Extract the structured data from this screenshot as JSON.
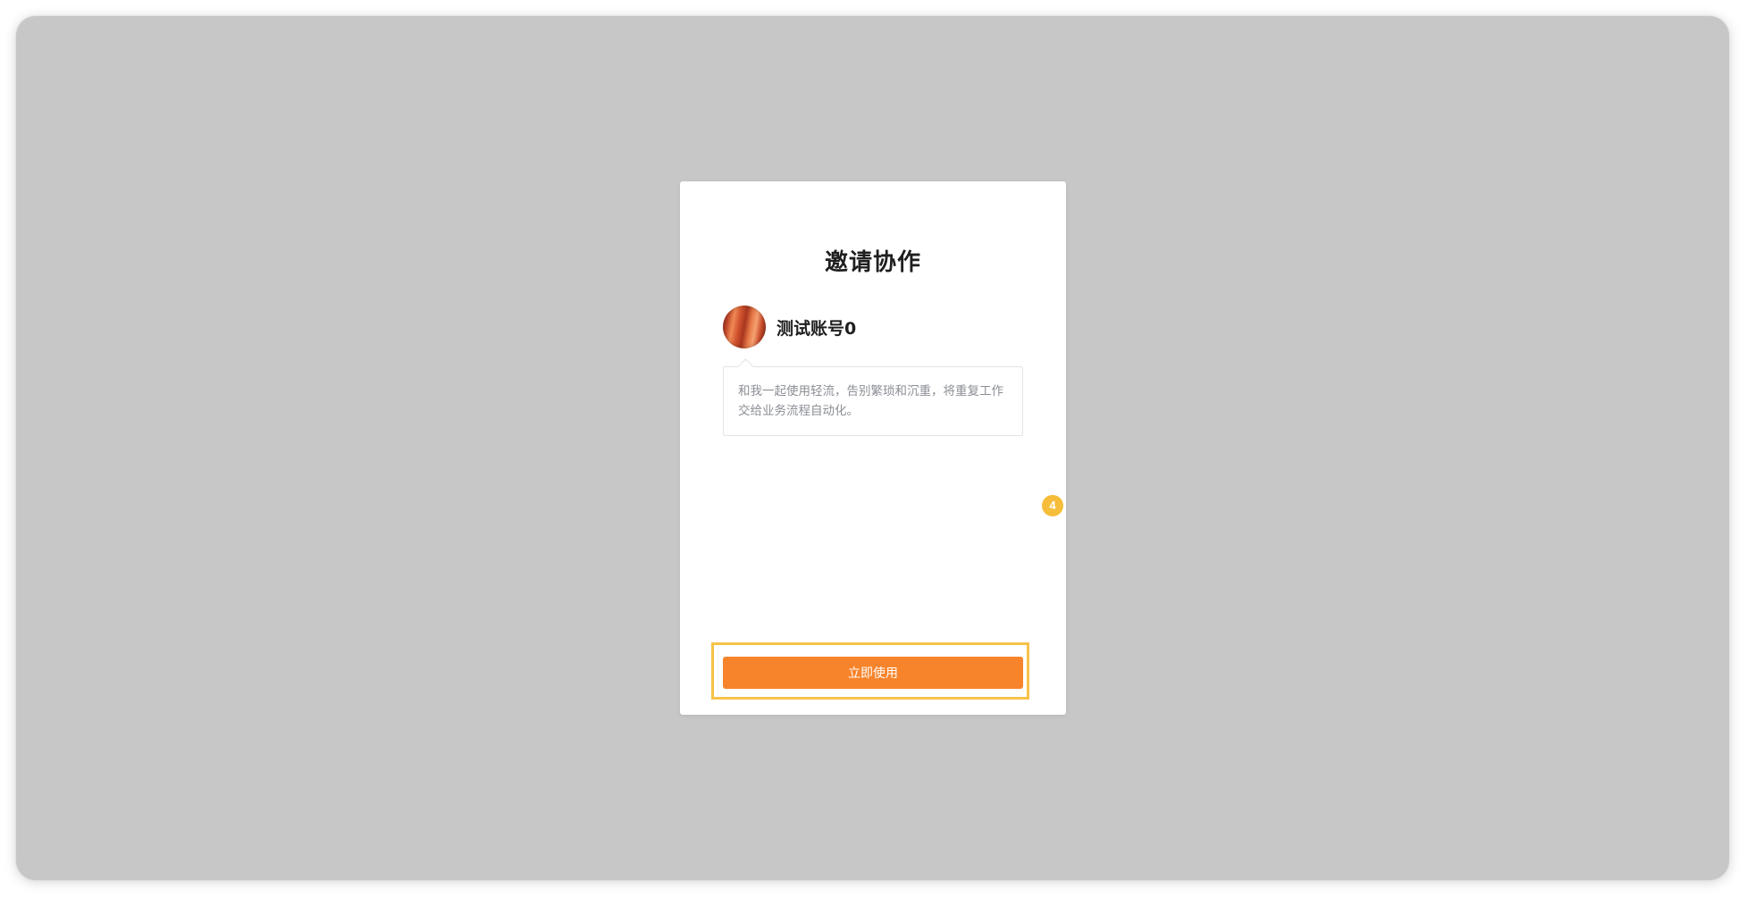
{
  "dialog": {
    "title": "邀请协作",
    "sender": {
      "avatar_icon": "user-avatar-image",
      "name": "测试账号0"
    },
    "message": "和我一起使用轻流，告别繁琐和沉重，将重复工作交给业务流程自动化。",
    "action_label": "立即使用"
  },
  "annotation": {
    "step_number": "4",
    "highlight_color": "#f7c14a"
  },
  "colors": {
    "backdrop": "#c7c7c7",
    "primary": "#f7842b",
    "badge": "#f6bd3a"
  }
}
